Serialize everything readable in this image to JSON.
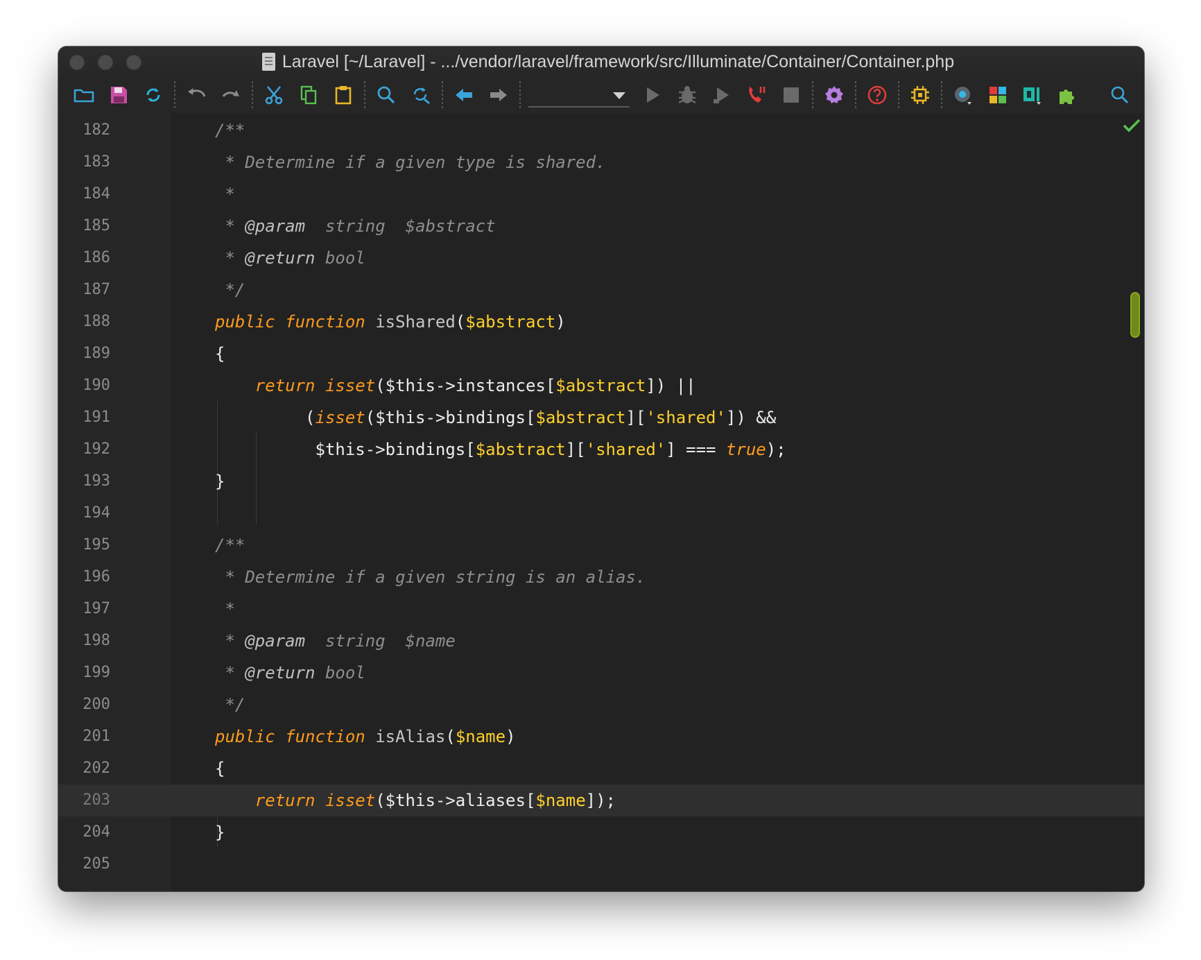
{
  "window": {
    "title": "Laravel [~/Laravel] - .../vendor/laravel/framework/src/Illuminate/Container/Container.php"
  },
  "toolbar": {
    "run_configuration": "",
    "icons": [
      "open-folder-icon",
      "save-icon",
      "sync-icon",
      "undo-icon",
      "redo-icon",
      "cut-icon",
      "copy-icon",
      "paste-icon",
      "find-icon",
      "replace-icon",
      "back-arrow-icon",
      "forward-arrow-icon",
      "run-icon",
      "debug-icon",
      "run-with-coverage-icon",
      "phone-stop-listening-icon",
      "stop-icon",
      "settings-gear-icon",
      "help-icon",
      "plugin-chip-icon",
      "database-icon",
      "structure-icon",
      "data-sources-icon",
      "plugins-puzzle-icon",
      "search-everywhere-icon"
    ]
  },
  "status": {
    "inspection": "check-icon"
  },
  "colors": {
    "keyword": "#fe9b1e",
    "variable": "#fed02c",
    "comment": "#8e8e8e",
    "background": "#222222"
  },
  "editor": {
    "current_line": 203,
    "lines": [
      {
        "n": "182",
        "tokens": [
          {
            "t": "/**",
            "c": "cm"
          }
        ]
      },
      {
        "n": "183",
        "tokens": [
          {
            "t": " * Determine if a given type is shared.",
            "c": "cm"
          }
        ]
      },
      {
        "n": "184",
        "tokens": [
          {
            "t": " *",
            "c": "cm"
          }
        ]
      },
      {
        "n": "185",
        "tokens": [
          {
            "t": " * ",
            "c": "cm"
          },
          {
            "t": "@param",
            "c": "tg"
          },
          {
            "t": "  string  $abstract",
            "c": "cm"
          }
        ]
      },
      {
        "n": "186",
        "tokens": [
          {
            "t": " * ",
            "c": "cm"
          },
          {
            "t": "@return",
            "c": "tg"
          },
          {
            "t": " bool",
            "c": "cm"
          }
        ]
      },
      {
        "n": "187",
        "tokens": [
          {
            "t": " */",
            "c": "cm"
          }
        ]
      },
      {
        "n": "188",
        "tokens": [
          {
            "t": "public",
            "c": "kw"
          },
          {
            "t": " ",
            "c": "pl"
          },
          {
            "t": "function",
            "c": "kw"
          },
          {
            "t": " ",
            "c": "pl"
          },
          {
            "t": "isShared",
            "c": "fname"
          },
          {
            "t": "(",
            "c": "pl"
          },
          {
            "t": "$abstract",
            "c": "vr"
          },
          {
            "t": ")",
            "c": "pl"
          }
        ]
      },
      {
        "n": "189",
        "tokens": [
          {
            "t": "{",
            "c": "pl"
          }
        ]
      },
      {
        "n": "190",
        "tokens": [
          {
            "t": "    ",
            "c": "pl"
          },
          {
            "t": "return",
            "c": "kw"
          },
          {
            "t": " ",
            "c": "pl"
          },
          {
            "t": "isset",
            "c": "kw"
          },
          {
            "t": "($this->instances[",
            "c": "pl"
          },
          {
            "t": "$abstract",
            "c": "vr"
          },
          {
            "t": "]) ||",
            "c": "pl"
          }
        ]
      },
      {
        "n": "191",
        "tokens": [
          {
            "t": "         (",
            "c": "pl"
          },
          {
            "t": "isset",
            "c": "kw"
          },
          {
            "t": "($this->bindings[",
            "c": "pl"
          },
          {
            "t": "$abstract",
            "c": "vr"
          },
          {
            "t": "][",
            "c": "pl"
          },
          {
            "t": "'shared'",
            "c": "st"
          },
          {
            "t": "]) &&",
            "c": "pl"
          }
        ]
      },
      {
        "n": "192",
        "tokens": [
          {
            "t": "          $this->bindings[",
            "c": "pl"
          },
          {
            "t": "$abstract",
            "c": "vr"
          },
          {
            "t": "][",
            "c": "pl"
          },
          {
            "t": "'shared'",
            "c": "st"
          },
          {
            "t": "] === ",
            "c": "pl"
          },
          {
            "t": "true",
            "c": "kw"
          },
          {
            "t": ");",
            "c": "pl"
          }
        ]
      },
      {
        "n": "193",
        "tokens": [
          {
            "t": "}",
            "c": "pl"
          }
        ]
      },
      {
        "n": "194",
        "tokens": []
      },
      {
        "n": "195",
        "tokens": [
          {
            "t": "/**",
            "c": "cm"
          }
        ]
      },
      {
        "n": "196",
        "tokens": [
          {
            "t": " * Determine if a given string is an alias.",
            "c": "cm"
          }
        ]
      },
      {
        "n": "197",
        "tokens": [
          {
            "t": " *",
            "c": "cm"
          }
        ]
      },
      {
        "n": "198",
        "tokens": [
          {
            "t": " * ",
            "c": "cm"
          },
          {
            "t": "@param",
            "c": "tg"
          },
          {
            "t": "  string  $name",
            "c": "cm"
          }
        ]
      },
      {
        "n": "199",
        "tokens": [
          {
            "t": " * ",
            "c": "cm"
          },
          {
            "t": "@return",
            "c": "tg"
          },
          {
            "t": " bool",
            "c": "cm"
          }
        ]
      },
      {
        "n": "200",
        "tokens": [
          {
            "t": " */",
            "c": "cm"
          }
        ]
      },
      {
        "n": "201",
        "tokens": [
          {
            "t": "public",
            "c": "kw"
          },
          {
            "t": " ",
            "c": "pl"
          },
          {
            "t": "function",
            "c": "kw"
          },
          {
            "t": " ",
            "c": "pl"
          },
          {
            "t": "isAlias",
            "c": "fname"
          },
          {
            "t": "(",
            "c": "pl"
          },
          {
            "t": "$name",
            "c": "vr"
          },
          {
            "t": ")",
            "c": "pl"
          }
        ]
      },
      {
        "n": "202",
        "tokens": [
          {
            "t": "{",
            "c": "pl"
          }
        ]
      },
      {
        "n": "203",
        "tokens": [
          {
            "t": "    ",
            "c": "pl"
          },
          {
            "t": "return",
            "c": "kw"
          },
          {
            "t": " ",
            "c": "pl"
          },
          {
            "t": "isset",
            "c": "kw"
          },
          {
            "t": "($this->aliases[",
            "c": "pl"
          },
          {
            "t": "$name",
            "c": "vr"
          },
          {
            "t": "]);",
            "c": "pl"
          }
        ]
      },
      {
        "n": "204",
        "tokens": [
          {
            "t": "}",
            "c": "pl"
          }
        ]
      },
      {
        "n": "205",
        "tokens": []
      }
    ]
  }
}
